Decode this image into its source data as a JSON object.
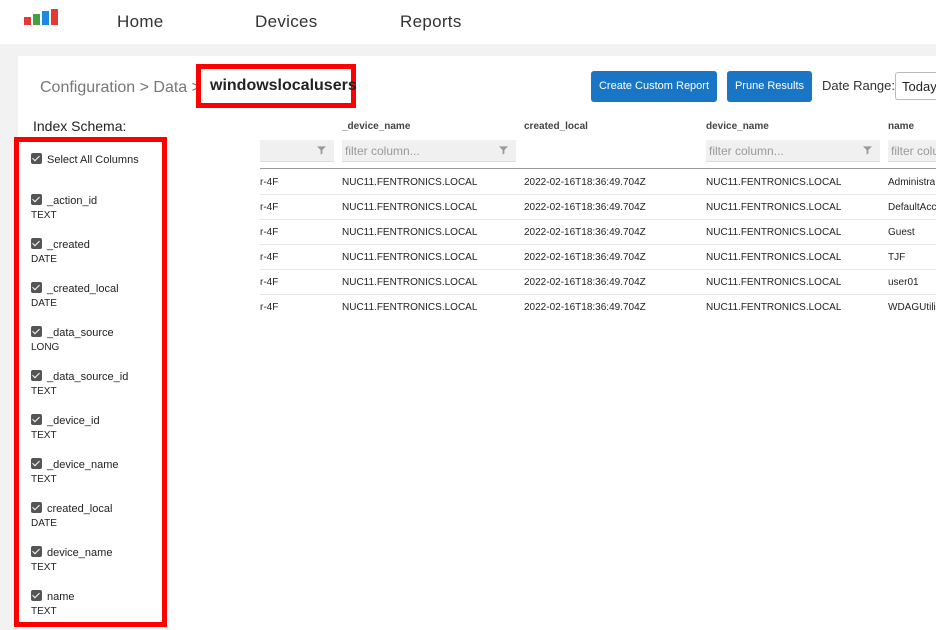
{
  "nav": {
    "items": [
      "Home",
      "Devices",
      "Reports"
    ],
    "logo_colors": [
      "#e53935",
      "#43a047",
      "#1e88e5",
      "#fbc02d"
    ]
  },
  "breadcrumb": {
    "path": "Configuration > Data >",
    "current": "windowslocalusers"
  },
  "toolbar": {
    "create_report_label": "Create Custom Report",
    "prune_label": "Prune Results",
    "date_range_label": "Date Range:",
    "date_range_value": "Today"
  },
  "schema": {
    "title": "Index Schema:",
    "select_all_label": "Select All Columns",
    "fields": [
      {
        "name": "_action_id",
        "type": "TEXT"
      },
      {
        "name": "_created",
        "type": "DATE"
      },
      {
        "name": "_created_local",
        "type": "DATE"
      },
      {
        "name": "_data_source",
        "type": "LONG"
      },
      {
        "name": "_data_source_id",
        "type": "TEXT"
      },
      {
        "name": "_device_id",
        "type": "TEXT"
      },
      {
        "name": "_device_name",
        "type": "TEXT"
      },
      {
        "name": "created_local",
        "type": "DATE"
      },
      {
        "name": "device_name",
        "type": "TEXT"
      },
      {
        "name": "name",
        "type": "TEXT"
      }
    ]
  },
  "grid": {
    "filter_placeholder": "filter column...",
    "filter_placeholder_clipped": "filter colu",
    "columns": [
      "_device_name",
      "created_local",
      "device_name",
      "name"
    ],
    "rows": [
      [
        "r-4F",
        "NUC11.FENTRONICS.LOCAL",
        "2022-02-16T18:36:49.704Z",
        "NUC11.FENTRONICS.LOCAL",
        "Administra"
      ],
      [
        "r-4F",
        "NUC11.FENTRONICS.LOCAL",
        "2022-02-16T18:36:49.704Z",
        "NUC11.FENTRONICS.LOCAL",
        "DefaultAcc"
      ],
      [
        "r-4F",
        "NUC11.FENTRONICS.LOCAL",
        "2022-02-16T18:36:49.704Z",
        "NUC11.FENTRONICS.LOCAL",
        "Guest"
      ],
      [
        "r-4F",
        "NUC11.FENTRONICS.LOCAL",
        "2022-02-16T18:36:49.704Z",
        "NUC11.FENTRONICS.LOCAL",
        "TJF"
      ],
      [
        "r-4F",
        "NUC11.FENTRONICS.LOCAL",
        "2022-02-16T18:36:49.704Z",
        "NUC11.FENTRONICS.LOCAL",
        "user01"
      ],
      [
        "r-4F",
        "NUC11.FENTRONICS.LOCAL",
        "2022-02-16T18:36:49.704Z",
        "NUC11.FENTRONICS.LOCAL",
        "WDAGUtili"
      ]
    ]
  },
  "colors": {
    "accent": "#1976c6",
    "highlight": "#ff0000"
  }
}
